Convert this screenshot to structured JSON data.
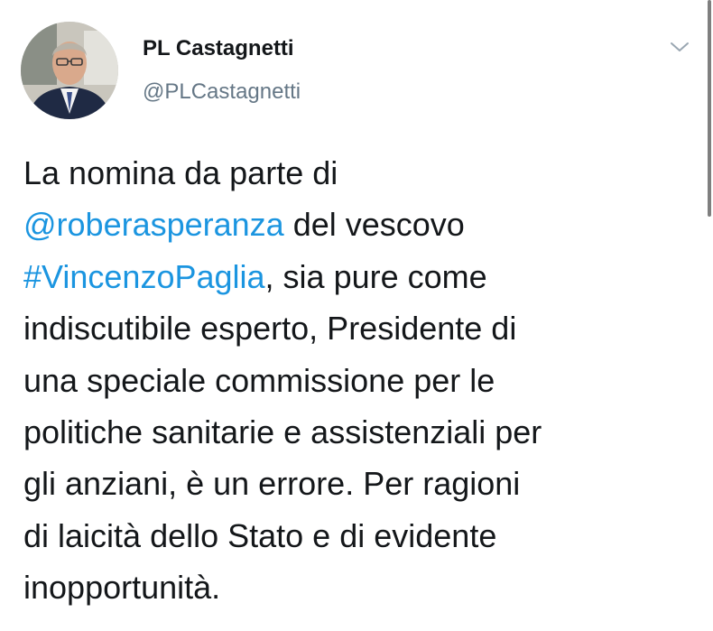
{
  "author": {
    "display_name": "PL Castagnetti",
    "handle": "@PLCastagnetti",
    "avatar_icon": "profile-photo"
  },
  "menu": {
    "icon": "chevron-down-icon"
  },
  "colors": {
    "link": "#1b95e0",
    "text": "#14171a",
    "muted": "#657786"
  },
  "tweet": {
    "lines": [
      [
        {
          "text": "La nomina da parte di"
        }
      ],
      [
        {
          "text": "@roberasperanza",
          "type": "mention"
        },
        {
          "text": " del vescovo"
        }
      ],
      [
        {
          "text": "#VincenzoPaglia",
          "type": "hashtag"
        },
        {
          "text": ", sia pure come"
        }
      ],
      [
        {
          "text": "indiscutibile esperto, Presidente di"
        }
      ],
      [
        {
          "text": "una speciale commissione per le"
        }
      ],
      [
        {
          "text": "politiche sanitarie e assistenziali per"
        }
      ],
      [
        {
          "text": "gli anziani, è un errore. Per ragioni"
        }
      ],
      [
        {
          "text": "di laicità dello Stato e di evidente"
        }
      ],
      [
        {
          "text": "inopportunità."
        }
      ]
    ]
  }
}
